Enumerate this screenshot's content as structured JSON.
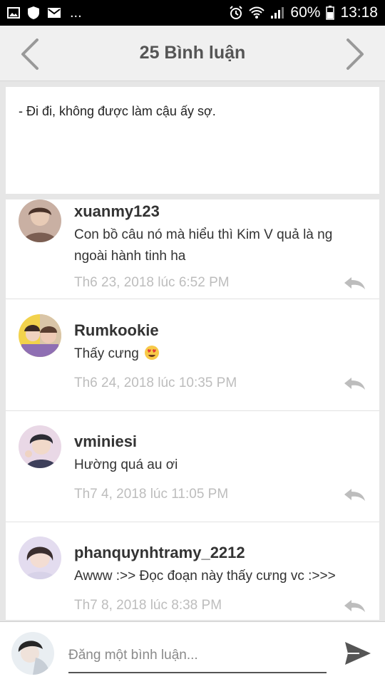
{
  "status_bar": {
    "battery": "60%",
    "time": "13:18",
    "more": "...",
    "icons": [
      "image-notification-icon",
      "shield-icon",
      "mail-icon",
      "alarm-icon",
      "wifi-icon",
      "signal-icon",
      "battery-icon"
    ]
  },
  "header": {
    "title": "25 Bình luận",
    "prev_icon": "chevron-left-icon",
    "next_icon": "chevron-right-icon"
  },
  "quote": {
    "text": "- Đi đi, không được làm cậu ấy sợ."
  },
  "comments": [
    {
      "user": "xuanmy123",
      "body": "Con bồ câu nó mà hiểu thì Kim V quả là ng ngoài hành tinh ha",
      "time": "Th6 23, 2018 lúc 6:52 PM",
      "emoji": ""
    },
    {
      "user": "Rumkookie",
      "body": "Thấy cưng",
      "time": "Th6 24, 2018 lúc 10:35 PM",
      "emoji": "heart-eyes-emoji"
    },
    {
      "user": "vminiesi",
      "body": "Hường quá au ơi",
      "time": "Th7 4, 2018 lúc 11:05 PM",
      "emoji": ""
    },
    {
      "user": "phanquynhtramy_2212",
      "body": "Awww :>> Đọc đoạn này thấy cưng vc :>>>",
      "time": "Th7 8, 2018 lúc 8:38 PM",
      "emoji": ""
    }
  ],
  "composer": {
    "placeholder": "Đăng một bình luận...",
    "send_icon": "send-icon"
  },
  "colors": {
    "header_bg": "#f0f0f0",
    "timestamp": "#bdbdbd",
    "text": "#333333"
  }
}
